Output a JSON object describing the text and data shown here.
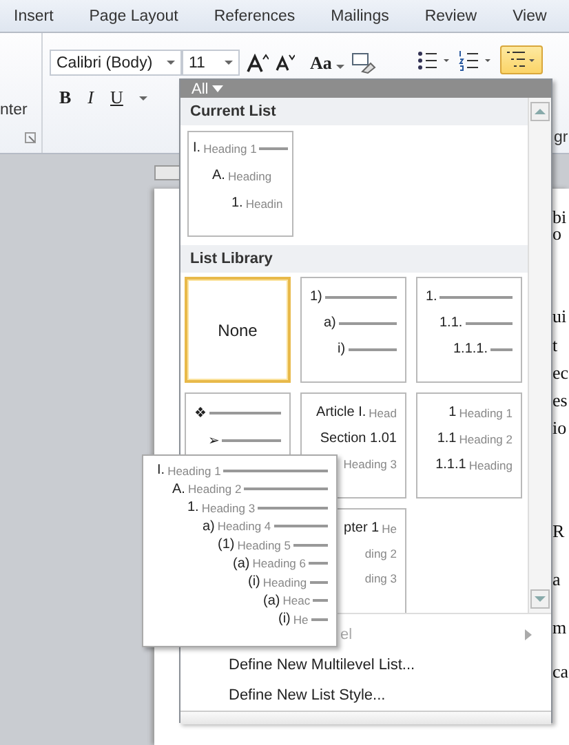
{
  "ribbon_tabs": [
    {
      "label": "Insert"
    },
    {
      "label": "Page Layout"
    },
    {
      "label": "References"
    },
    {
      "label": "Mailings"
    },
    {
      "label": "Review"
    },
    {
      "label": "View"
    }
  ],
  "left_group_label": "nter",
  "font_name": "Calibri (Body)",
  "font_size": "11",
  "change_case": "Aa",
  "format_buttons": [
    "B",
    "I",
    "U"
  ],
  "paragraph_label": "gr",
  "multilevel_button": {
    "selected": true
  },
  "document_fragments": [
    "bi",
    "o",
    "ui",
    "t",
    "ec",
    "es",
    "io",
    "R",
    "a",
    "m",
    "ca"
  ],
  "dropdown": {
    "filter": "All",
    "current_list": {
      "title": "Current List",
      "lines": [
        {
          "number": "I.",
          "text": "Heading 1"
        },
        {
          "number": "A.",
          "text": "Heading"
        },
        {
          "number": "1.",
          "text": "Headin"
        }
      ]
    },
    "library": {
      "title": "List Library",
      "items": [
        {
          "kind": "none",
          "label": "None",
          "selected": true
        },
        {
          "kind": "levels",
          "selected": false,
          "lines": [
            {
              "number": "1)"
            },
            {
              "number": "a)"
            },
            {
              "number": "i)"
            }
          ]
        },
        {
          "kind": "levels",
          "selected": false,
          "lines": [
            {
              "number": "1."
            },
            {
              "number": "1.1."
            },
            {
              "number": "1.1.1."
            }
          ]
        },
        {
          "kind": "levels",
          "selected": false,
          "lines": [
            {
              "number": "❖"
            },
            {
              "number": "➢"
            }
          ]
        },
        {
          "kind": "levels",
          "selected": false,
          "lines": [
            {
              "number": "Article I.",
              "text": "Head"
            },
            {
              "number": "Section 1.01"
            },
            {
              "text": "Heading 3"
            }
          ]
        },
        {
          "kind": "levels",
          "selected": false,
          "lines": [
            {
              "number": "1",
              "text": "Heading 1"
            },
            {
              "number": "1.1",
              "text": "Heading 2"
            },
            {
              "number": "1.1.1",
              "text": "Heading"
            }
          ]
        },
        {
          "kind": "levels",
          "selected": false,
          "lines": [
            {
              "number": "pter 1",
              "text": "He"
            },
            {
              "text": "ding 2"
            },
            {
              "text": "ding 3"
            }
          ]
        }
      ]
    },
    "menu": [
      {
        "label": "el",
        "disabled": true,
        "submenu": true
      },
      {
        "label": "Define New Multilevel List...",
        "disabled": false,
        "submenu": false
      },
      {
        "label": "Define New List Style...",
        "disabled": false,
        "submenu": false
      }
    ]
  },
  "preview": {
    "lines": [
      {
        "number": "I.",
        "text": "Heading 1"
      },
      {
        "number": "A.",
        "text": "Heading 2"
      },
      {
        "number": "1.",
        "text": "Heading 3"
      },
      {
        "number": "a)",
        "text": "Heading 4"
      },
      {
        "number": "(1)",
        "text": "Heading 5"
      },
      {
        "number": "(a)",
        "text": "Heading 6"
      },
      {
        "number": "(i)",
        "text": "Heading"
      },
      {
        "number": "(a)",
        "text": "Heac"
      },
      {
        "number": "(i)",
        "text": "He"
      }
    ]
  }
}
